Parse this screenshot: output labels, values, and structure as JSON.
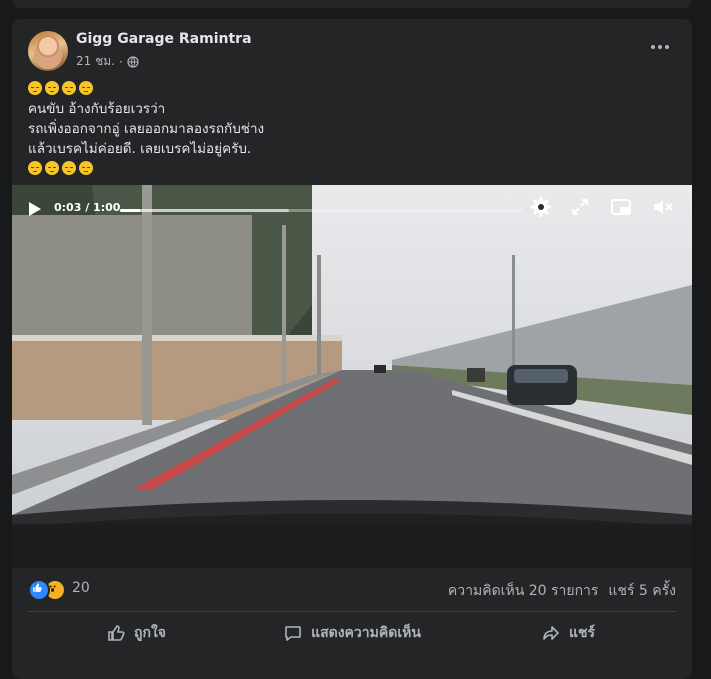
{
  "post": {
    "page_name": "Gigg Garage Ramintra",
    "time": "21 ชม.",
    "text_lines": [
      "คนขับ อ้างกับร้อยเวรว่า",
      "รถเพิ่งออกจากอู่ เลยออกมาลองรถกับช่าง",
      "แล้วเบรคไม่ค่อยดี. เลยเบรคไม่อยู่ครับ."
    ],
    "emoji_name": "sleepy-face"
  },
  "video": {
    "current_time": "0:03",
    "duration": "1:00",
    "time_label": "0:03 / 1:00",
    "progress": 0.05,
    "buffered": 0.42
  },
  "stats": {
    "reaction_count": "20",
    "comments": "ความคิดเห็น 20 รายการ",
    "shares": "แชร์ 5 ครั้ง"
  },
  "actions": {
    "like": "ถูกใจ",
    "comment": "แสดงความคิดเห็น",
    "share": "แชร์"
  },
  "colors": {
    "card_bg": "#242526",
    "page_bg": "#18191a",
    "text_primary": "#e4e6eb",
    "text_secondary": "#b0b3b8",
    "like_blue": "#2d88ff",
    "wow_yellow": "#f7b125"
  }
}
